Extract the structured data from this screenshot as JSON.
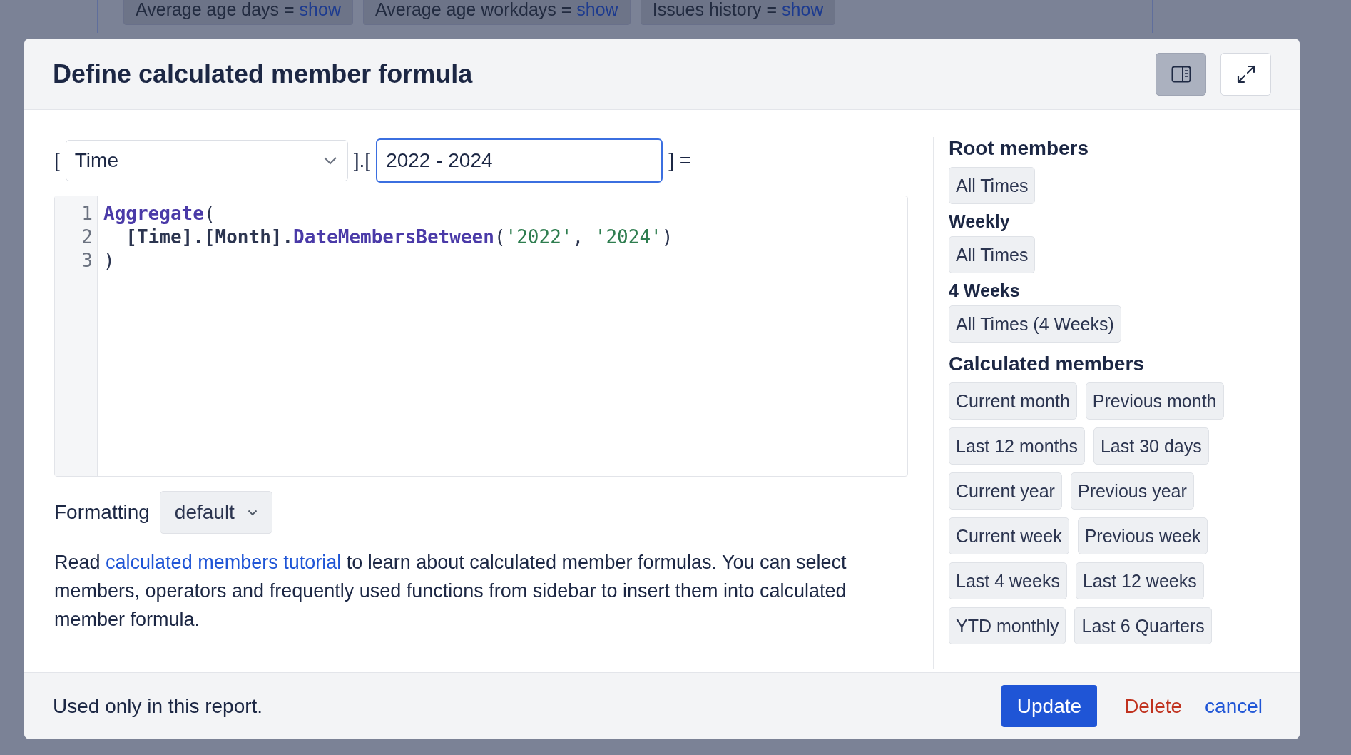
{
  "background": {
    "chips": [
      {
        "label": "Average age days =",
        "link": "show"
      },
      {
        "label": "Average age workdays =",
        "link": "show"
      },
      {
        "label": "Issues history =",
        "link": "show"
      }
    ]
  },
  "dialog": {
    "title": "Define calculated member formula",
    "layout_toggle": {
      "selected": true
    }
  },
  "member_name": {
    "open_bracket": "[",
    "dimension": "Time",
    "separator": "].[",
    "name": "2022 - 2024",
    "close": "] ="
  },
  "editor": {
    "lines": [
      {
        "number": "1",
        "indented": false,
        "tokens": [
          {
            "kind": "function",
            "text": "Aggregate"
          },
          {
            "kind": "plain",
            "text": "("
          }
        ]
      },
      {
        "number": "2",
        "indented": true,
        "tokens": [
          {
            "kind": "member",
            "text": "[Time].[Month]."
          },
          {
            "kind": "function",
            "text": "DateMembersBetween"
          },
          {
            "kind": "plain",
            "text": "("
          },
          {
            "kind": "string",
            "text": "'2022'"
          },
          {
            "kind": "plain",
            "text": ", "
          },
          {
            "kind": "string",
            "text": "'2024'"
          },
          {
            "kind": "plain",
            "text": ")"
          }
        ]
      },
      {
        "number": "3",
        "indented": false,
        "tokens": [
          {
            "kind": "plain",
            "text": ")"
          }
        ]
      }
    ]
  },
  "formatting": {
    "label": "Formatting",
    "value": "default"
  },
  "help": {
    "before": "Read",
    "link": "calculated members tutorial",
    "after": "to learn about calculated member formulas. You can select members, operators and frequently used functions from sidebar to insert them into calculated member formula."
  },
  "sidebar": {
    "sections": [
      {
        "kind": "major",
        "title": "Root members",
        "items": [
          "All Times"
        ]
      },
      {
        "kind": "minor",
        "title": "Weekly",
        "items": [
          "All Times"
        ]
      },
      {
        "kind": "minor",
        "title": "4 Weeks",
        "items": [
          "All Times (4 Weeks)"
        ]
      },
      {
        "kind": "major",
        "title": "Calculated members",
        "items": [
          "Current month",
          "Previous month",
          "Last 12 months",
          "Last 30 days",
          "Current year",
          "Previous year",
          "Current week",
          "Previous week",
          "Last 4 weeks",
          "Last 12 weeks",
          "YTD monthly",
          "Last 6 Quarters"
        ]
      }
    ]
  },
  "footer": {
    "note": "Used only in this report.",
    "buttons": [
      {
        "kind": "primary",
        "label": "Update"
      },
      {
        "kind": "danger",
        "label": "Delete"
      },
      {
        "kind": "link",
        "label": "cancel"
      }
    ]
  }
}
